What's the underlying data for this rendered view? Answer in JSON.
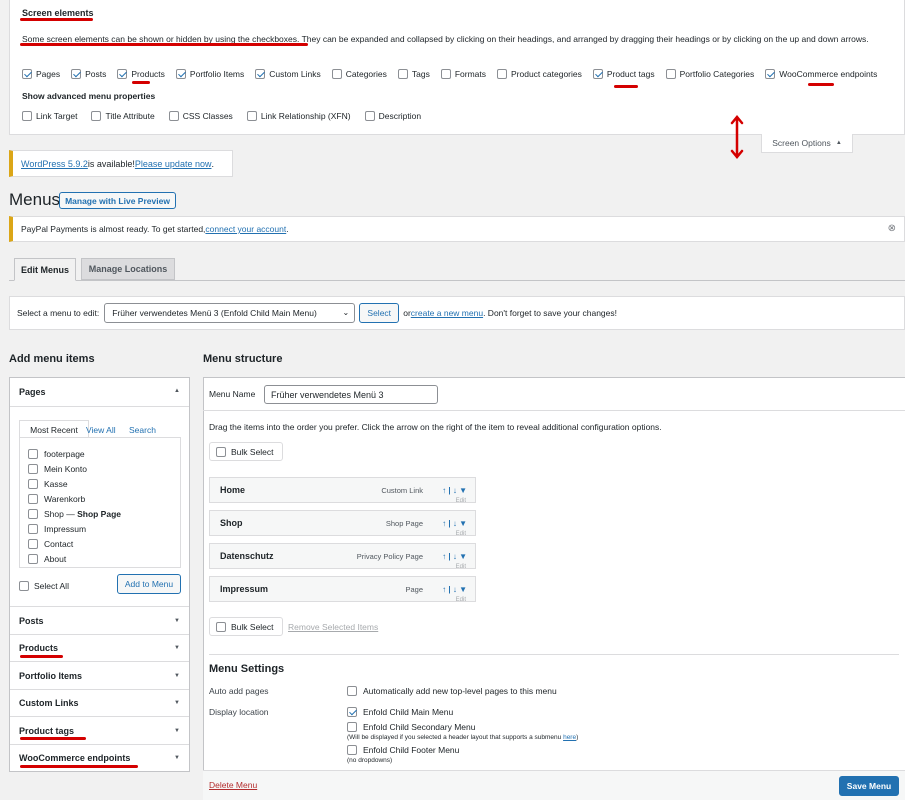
{
  "screen_options": {
    "title": "Screen elements",
    "description_part1": "Some screen elements can be shown or hidden by using the checkboxes.",
    "description_part2": " They can be expanded and collapsed by clicking on their headings, and arranged by dragging their headings or by clicking on the up and down arrows.",
    "boxes": [
      {
        "label": "Pages",
        "checked": true
      },
      {
        "label": "Posts",
        "checked": true
      },
      {
        "label": "Products",
        "checked": true
      },
      {
        "label": "Portfolio Items",
        "checked": true
      },
      {
        "label": "Custom Links",
        "checked": true
      },
      {
        "label": "Categories",
        "checked": false
      },
      {
        "label": "Tags",
        "checked": false
      },
      {
        "label": "Formats",
        "checked": false
      },
      {
        "label": "Product categories",
        "checked": false
      },
      {
        "label": "Product tags",
        "checked": true
      },
      {
        "label": "Portfolio Categories",
        "checked": false
      },
      {
        "label": "WooCommerce endpoints",
        "checked": true
      }
    ],
    "advanced_title": "Show advanced menu properties",
    "advanced": [
      {
        "label": "Link Target",
        "checked": false
      },
      {
        "label": "Title Attribute",
        "checked": false
      },
      {
        "label": "CSS Classes",
        "checked": false
      },
      {
        "label": "Link Relationship (XFN)",
        "checked": false
      },
      {
        "label": "Description",
        "checked": false
      }
    ],
    "toggle_label": "Screen Options",
    "toggle_arrow": "▲"
  },
  "update_notice": {
    "link1": "WordPress 5.9.2",
    "text": " is available! ",
    "link2": "Please update now",
    "end": "."
  },
  "page": {
    "title": "Menus",
    "live_preview_button": "Manage with Live Preview"
  },
  "paypal_notice": {
    "text": "PayPal Payments is almost ready. To get started, ",
    "link": "connect your account",
    "end": ".",
    "dismiss": "⊗"
  },
  "tabs": [
    "Edit Menus",
    "Manage Locations"
  ],
  "select_bar": {
    "label": "Select a menu to edit:",
    "selected": "Früher verwendetes Menü 3 (Enfold Child Main Menu)",
    "select_button": "Select",
    "or": "or ",
    "create_link": "create a new menu",
    "tail": ". Don't forget to save your changes!"
  },
  "add_items": {
    "heading": "Add menu items",
    "pages_title": "Pages",
    "subtabs": [
      "Most Recent",
      "View All",
      "Search"
    ],
    "pages": [
      {
        "label": "footerpage",
        "bold": ""
      },
      {
        "label": "Mein Konto",
        "bold": ""
      },
      {
        "label": "Kasse",
        "bold": ""
      },
      {
        "label": "Warenkorb",
        "bold": ""
      },
      {
        "label": "Shop — ",
        "bold": "Shop Page"
      },
      {
        "label": "Impressum",
        "bold": ""
      },
      {
        "label": "Contact",
        "bold": ""
      },
      {
        "label": "About",
        "bold": ""
      }
    ],
    "select_all": "Select All",
    "add_button": "Add to Menu",
    "sections": [
      "Posts",
      "Products",
      "Portfolio Items",
      "Custom Links",
      "Product tags",
      "WooCommerce endpoints"
    ]
  },
  "structure": {
    "heading": "Menu structure",
    "name_label": "Menu Name",
    "name_value": "Früher verwendetes Menü 3",
    "instructions": "Drag the items into the order you prefer. Click the arrow on the right of the item to reveal additional configuration options.",
    "bulk_select": "Bulk Select",
    "items": [
      {
        "title": "Home",
        "type": "Custom Link"
      },
      {
        "title": "Shop",
        "type": "Shop Page"
      },
      {
        "title": "Datenschutz",
        "type": "Privacy Policy Page"
      },
      {
        "title": "Impressum",
        "type": "Page"
      }
    ],
    "item_arrows": "↑ | ↓  ▼",
    "edit_hint": "Edit",
    "remove_selected": "Remove Selected Items",
    "settings_heading": "Menu Settings",
    "auto_add_label": "Auto add pages",
    "auto_add_option": "Automatically add new top-level pages to this menu",
    "display_location_label": "Display location",
    "locations": [
      {
        "label": "Enfold Child Main Menu",
        "checked": true,
        "note": "",
        "note_link": "",
        "note_end": ""
      },
      {
        "label": "Enfold Child Secondary Menu",
        "checked": false,
        "note": "(Will be displayed if you selected a header layout that supports a submenu ",
        "note_link": "here",
        "note_end": ")"
      },
      {
        "label": "Enfold Child Footer Menu",
        "checked": false,
        "note": "(no dropdowns)",
        "note_link": "",
        "note_end": ""
      }
    ],
    "delete_link": "Delete Menu",
    "save_button": "Save Menu"
  },
  "colors": {
    "accent": "#2271b1",
    "annotation": "#d40000",
    "notice_yellow": "#dba617"
  }
}
